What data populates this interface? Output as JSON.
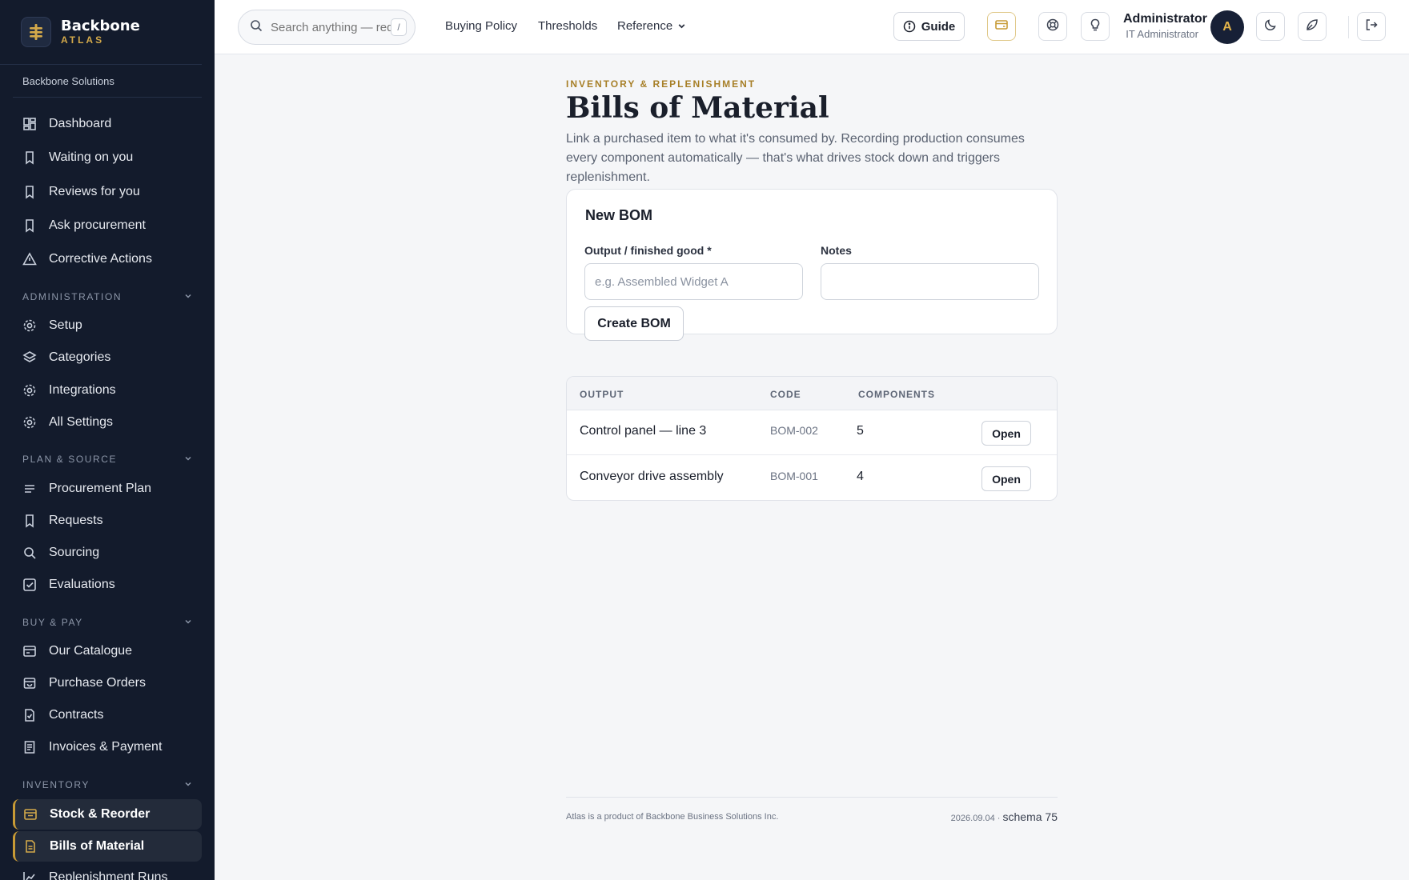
{
  "brand": {
    "name": "Backbone",
    "sub": "ATLAS",
    "org": "Backbone Solutions"
  },
  "sidebar": {
    "top_items": [
      {
        "label": "Dashboard",
        "icon": "dashboard-icon"
      },
      {
        "label": "Waiting on you",
        "icon": "bookmark-icon"
      },
      {
        "label": "Reviews for you",
        "icon": "bookmark-icon"
      },
      {
        "label": "Ask procurement",
        "icon": "bookmark-icon"
      },
      {
        "label": "Corrective Actions",
        "icon": "warning-triangle-icon"
      }
    ],
    "sections": [
      {
        "label": "ADMINISTRATION",
        "items": [
          {
            "label": "Setup",
            "icon": "gear-icon"
          },
          {
            "label": "Categories",
            "icon": "layers-icon"
          },
          {
            "label": "Integrations",
            "icon": "gear-icon"
          },
          {
            "label": "All Settings",
            "icon": "gear-icon"
          }
        ]
      },
      {
        "label": "PLAN & SOURCE",
        "items": [
          {
            "label": "Procurement Plan",
            "icon": "list-icon"
          },
          {
            "label": "Requests",
            "icon": "bookmark-icon"
          },
          {
            "label": "Sourcing",
            "icon": "search-icon"
          },
          {
            "label": "Evaluations",
            "icon": "checkbox-icon"
          }
        ]
      },
      {
        "label": "BUY & PAY",
        "items": [
          {
            "label": "Our Catalogue",
            "icon": "card-icon"
          },
          {
            "label": "Purchase Orders",
            "icon": "bag-icon"
          },
          {
            "label": "Contracts",
            "icon": "document-icon"
          },
          {
            "label": "Invoices & Payment",
            "icon": "receipt-icon"
          }
        ]
      },
      {
        "label": "INVENTORY",
        "items": [
          {
            "label": "Stock & Reorder",
            "icon": "box-icon",
            "active": true
          },
          {
            "label": "Bills of Material",
            "icon": "document-icon",
            "active": true
          },
          {
            "label": "Replenishment Runs",
            "icon": "chart-icon"
          }
        ]
      }
    ]
  },
  "topbar": {
    "search_placeholder": "Search anything — requests, POs, vendors",
    "search_shortcut": "/",
    "links": [
      "Buying Policy",
      "Thresholds",
      "Reference"
    ],
    "guide_label": "Guide",
    "user_name": "Administrator",
    "user_role": "IT Administrator",
    "avatar_initial": "A"
  },
  "page": {
    "eyebrow": "INVENTORY & REPLENISHMENT",
    "title": "Bills of Material",
    "description": "Link a purchased item to what it's consumed by. Recording production consumes every component automatically — that's what drives stock down and triggers replenishment."
  },
  "form": {
    "heading": "New BOM",
    "output_label": "Output / finished good *",
    "output_placeholder": "e.g. Assembled Widget A",
    "notes_label": "Notes",
    "notes_value": "",
    "submit_label": "Create BOM"
  },
  "table": {
    "headers": [
      "OUTPUT",
      "CODE",
      "COMPONENTS"
    ],
    "rows": [
      {
        "output": "Control panel — line 3",
        "code": "BOM-002",
        "components": "5",
        "action": "Open"
      },
      {
        "output": "Conveyor drive assembly",
        "code": "BOM-001",
        "components": "4",
        "action": "Open"
      }
    ]
  },
  "footer": {
    "left": "Atlas is a product of Backbone Business Solutions Inc.",
    "version": "2026.09.04 ·",
    "schema": "schema 75"
  },
  "colors": {
    "sidebar": "#131b2c",
    "accent": "#c79a35",
    "page_bg": "#f5f6f8"
  }
}
